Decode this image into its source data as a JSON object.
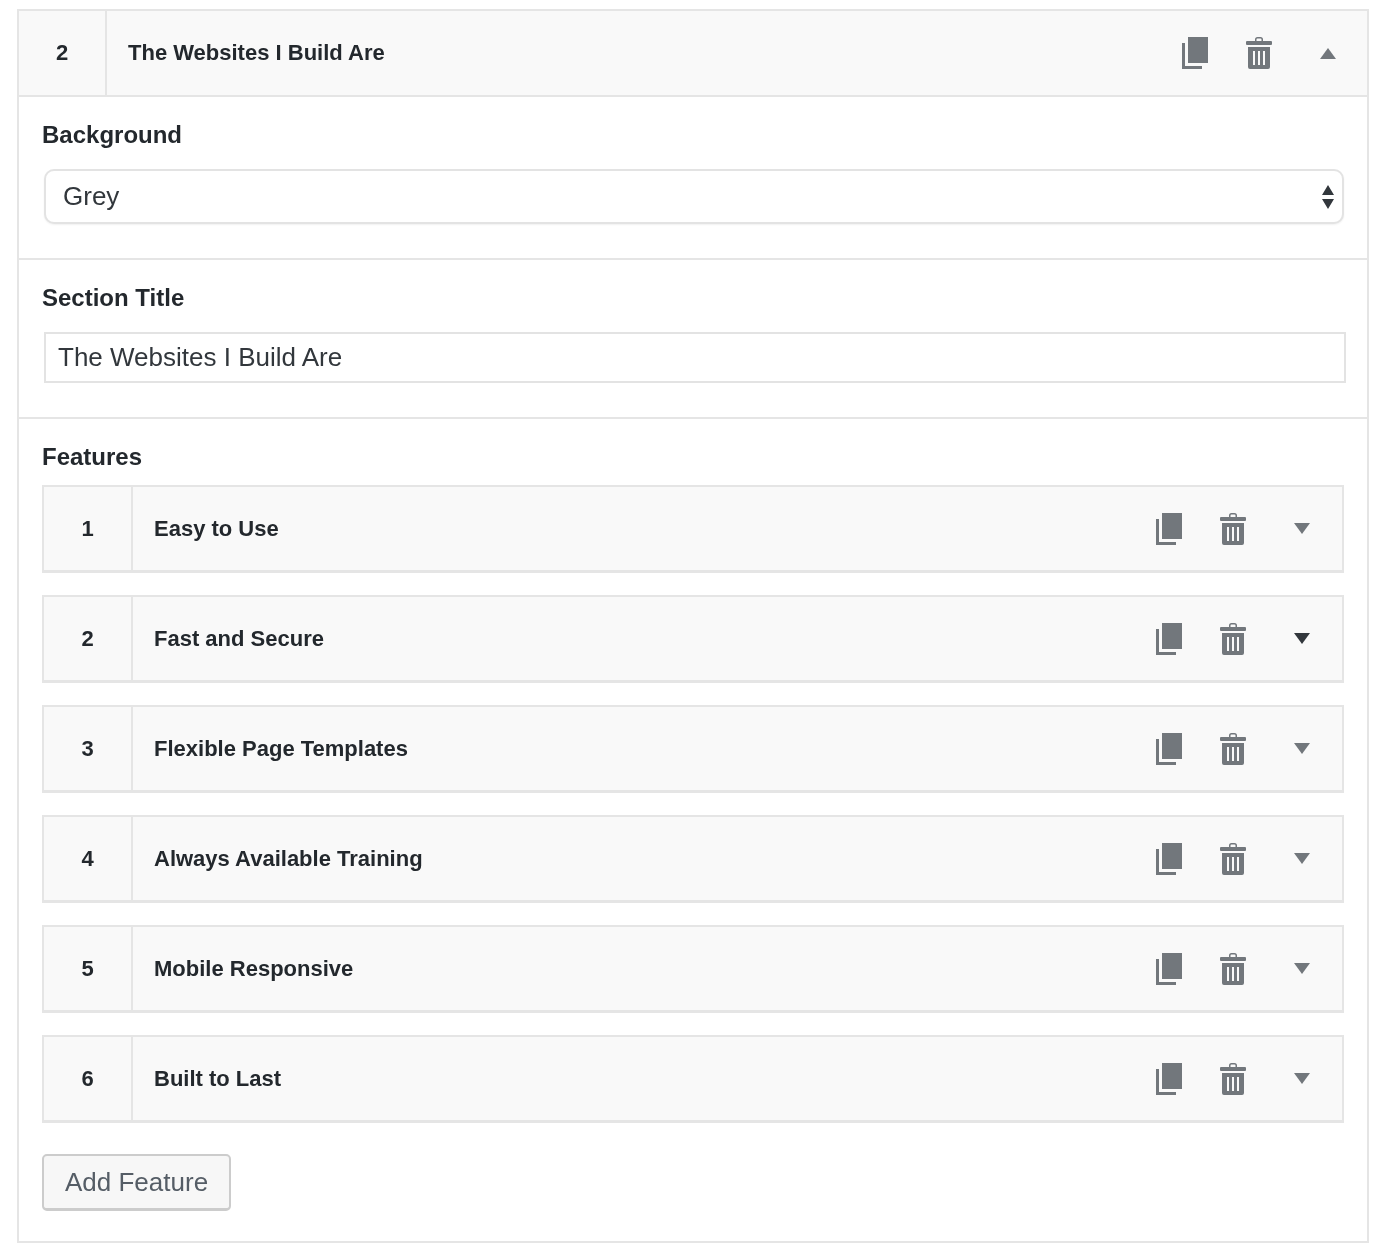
{
  "panel": {
    "number": "2",
    "title": "The Websites I Build Are",
    "expanded": true
  },
  "background": {
    "label": "Background",
    "value": "Grey"
  },
  "section_title": {
    "label": "Section Title",
    "value": "The Websites I Build Are"
  },
  "features": {
    "label": "Features",
    "items": [
      {
        "number": "1",
        "title": "Easy to Use",
        "expanded": false,
        "highlighted": false
      },
      {
        "number": "2",
        "title": "Fast and Secure",
        "expanded": false,
        "highlighted": true
      },
      {
        "number": "3",
        "title": "Flexible Page Templates",
        "expanded": false,
        "highlighted": false
      },
      {
        "number": "4",
        "title": "Always Available Training",
        "expanded": false,
        "highlighted": false
      },
      {
        "number": "5",
        "title": "Mobile Responsive",
        "expanded": false,
        "highlighted": false
      },
      {
        "number": "6",
        "title": "Built to Last",
        "expanded": false,
        "highlighted": false
      }
    ],
    "add_button": "Add Feature"
  }
}
